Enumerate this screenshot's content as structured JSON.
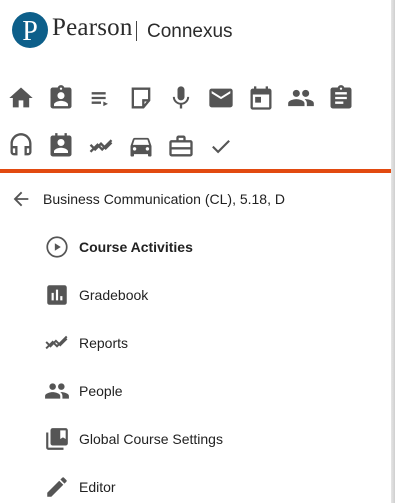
{
  "brand": {
    "name": "Pearson",
    "product": "Connexus",
    "brand_color": "#0d5f8a"
  },
  "toolbar": {
    "row1": [
      {
        "icon": "home-icon"
      },
      {
        "icon": "assignment-ind-icon"
      },
      {
        "icon": "playlist-icon"
      },
      {
        "icon": "sticky-note-icon"
      },
      {
        "icon": "microphone-icon"
      },
      {
        "icon": "mail-icon"
      },
      {
        "icon": "calendar-icon"
      },
      {
        "icon": "people-icon"
      },
      {
        "icon": "clipboard-icon"
      }
    ],
    "row2": [
      {
        "icon": "headset-icon"
      },
      {
        "icon": "badge-icon"
      },
      {
        "icon": "trend-icon"
      },
      {
        "icon": "bus-icon"
      },
      {
        "icon": "briefcase-icon"
      },
      {
        "icon": "check-icon"
      }
    ],
    "icon_color": "#555555"
  },
  "accent_color": "#e24a10",
  "course": {
    "title": "Business Communication (CL), 5.18, D"
  },
  "menu": [
    {
      "label": "Course Activities",
      "icon": "play-circle-icon",
      "active": true
    },
    {
      "label": "Gradebook",
      "icon": "bar-chart-icon",
      "active": false
    },
    {
      "label": "Reports",
      "icon": "trend-icon",
      "active": false
    },
    {
      "label": "People",
      "icon": "people-icon",
      "active": false
    },
    {
      "label": "Global Course Settings",
      "icon": "library-icon",
      "active": false
    },
    {
      "label": "Editor",
      "icon": "pencil-icon",
      "active": false
    }
  ]
}
